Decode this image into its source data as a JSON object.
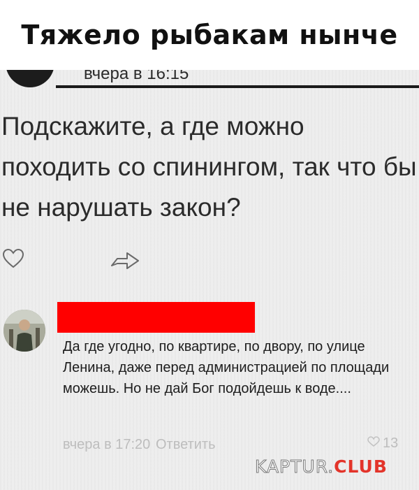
{
  "banner": {
    "title": "Тяжело рыбакам нынче"
  },
  "post": {
    "time": "вчера в 16:15",
    "text": "Подскажите, а где можно походить со спинингом, так что бы не нарушать закон?"
  },
  "actions": {
    "like_icon": "heart-outline-icon",
    "share_icon": "share-arrow-icon"
  },
  "reply": {
    "author_redacted": true,
    "redaction_color": "#ff0000",
    "text": "Да где угодно, по квартире, по двору, по улице Ленина, даже перед администрацией по площади можешь. Но не дай Бог подойдешь к воде....",
    "time": "вчера в 17:20",
    "reply_label": "Ответить",
    "likes": "13"
  },
  "watermark": {
    "part1": "KAPTUR.",
    "part2": "CLUB"
  }
}
